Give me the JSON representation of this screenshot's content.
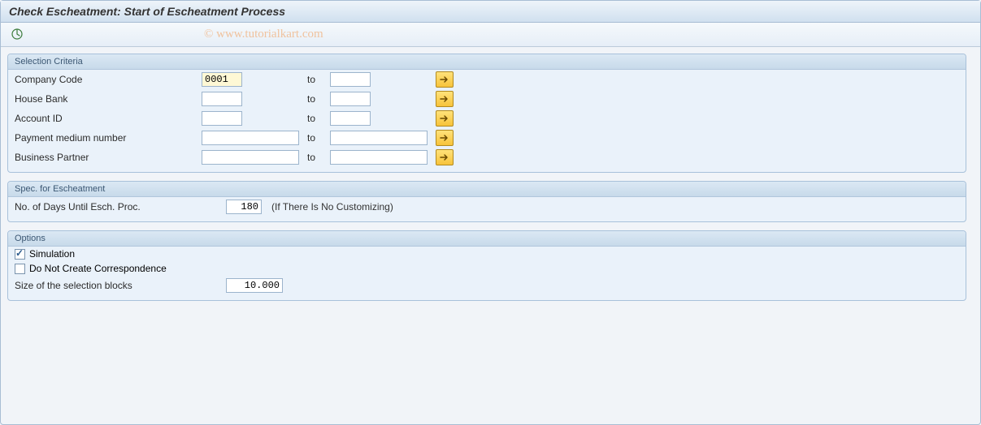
{
  "title": "Check Escheatment: Start of Escheatment Process",
  "watermark": "© www.tutorialkart.com",
  "groups": {
    "selection": {
      "title": "Selection Criteria",
      "rows": {
        "company": {
          "label": "Company Code",
          "from": "0001",
          "to_label": "to",
          "to": ""
        },
        "house_bank": {
          "label": "House Bank",
          "from": "",
          "to_label": "to",
          "to": ""
        },
        "account_id": {
          "label": "Account ID",
          "from": "",
          "to_label": "to",
          "to": ""
        },
        "payment_medium": {
          "label": "Payment medium number",
          "from": "",
          "to_label": "to",
          "to": ""
        },
        "business_partner": {
          "label": "Business Partner",
          "from": "",
          "to_label": "to",
          "to": ""
        }
      }
    },
    "spec": {
      "title": "Spec. for Escheatment",
      "days": {
        "label": "No. of Days Until Esch. Proc.",
        "value": "180",
        "note": "(If There Is No Customizing)"
      }
    },
    "options": {
      "title": "Options",
      "simulation": {
        "label": "Simulation",
        "checked": true
      },
      "no_correspondence": {
        "label": "Do Not Create Correspondence",
        "checked": false
      },
      "block_size": {
        "label": "Size of the selection blocks",
        "value": "10.000"
      }
    }
  }
}
